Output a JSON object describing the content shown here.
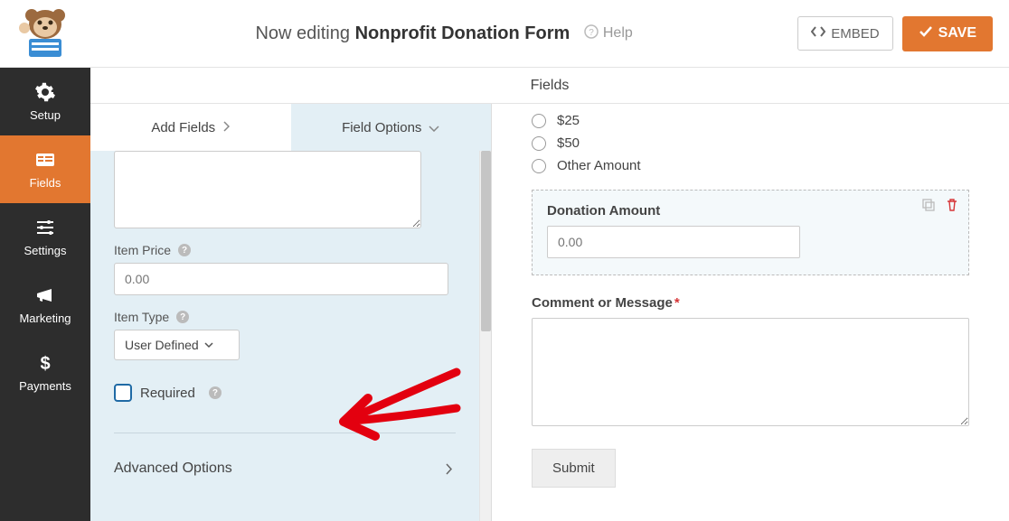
{
  "header": {
    "editing_prefix": "Now editing",
    "form_name": "Nonprofit Donation Form",
    "help_label": "Help",
    "embed_label": "EMBED",
    "save_label": "SAVE"
  },
  "sidenav": {
    "items": [
      {
        "label": "Setup",
        "name": "setup"
      },
      {
        "label": "Fields",
        "name": "fields"
      },
      {
        "label": "Settings",
        "name": "settings"
      },
      {
        "label": "Marketing",
        "name": "marketing"
      },
      {
        "label": "Payments",
        "name": "payments"
      }
    ],
    "active": "fields"
  },
  "columns_header": "Fields",
  "tabs": {
    "add_fields": "Add Fields",
    "field_options": "Field Options",
    "active": "field_options"
  },
  "field_options": {
    "item_price_label": "Item Price",
    "item_price_placeholder": "0.00",
    "item_type_label": "Item Type",
    "item_type_value": "User Defined",
    "required_label": "Required",
    "advanced_label": "Advanced Options"
  },
  "preview": {
    "radio_options": [
      "$25",
      "$50",
      "Other Amount"
    ],
    "donation_field_label": "Donation Amount",
    "donation_placeholder": "0.00",
    "comment_label": "Comment or Message",
    "comment_required": true,
    "submit_label": "Submit"
  }
}
